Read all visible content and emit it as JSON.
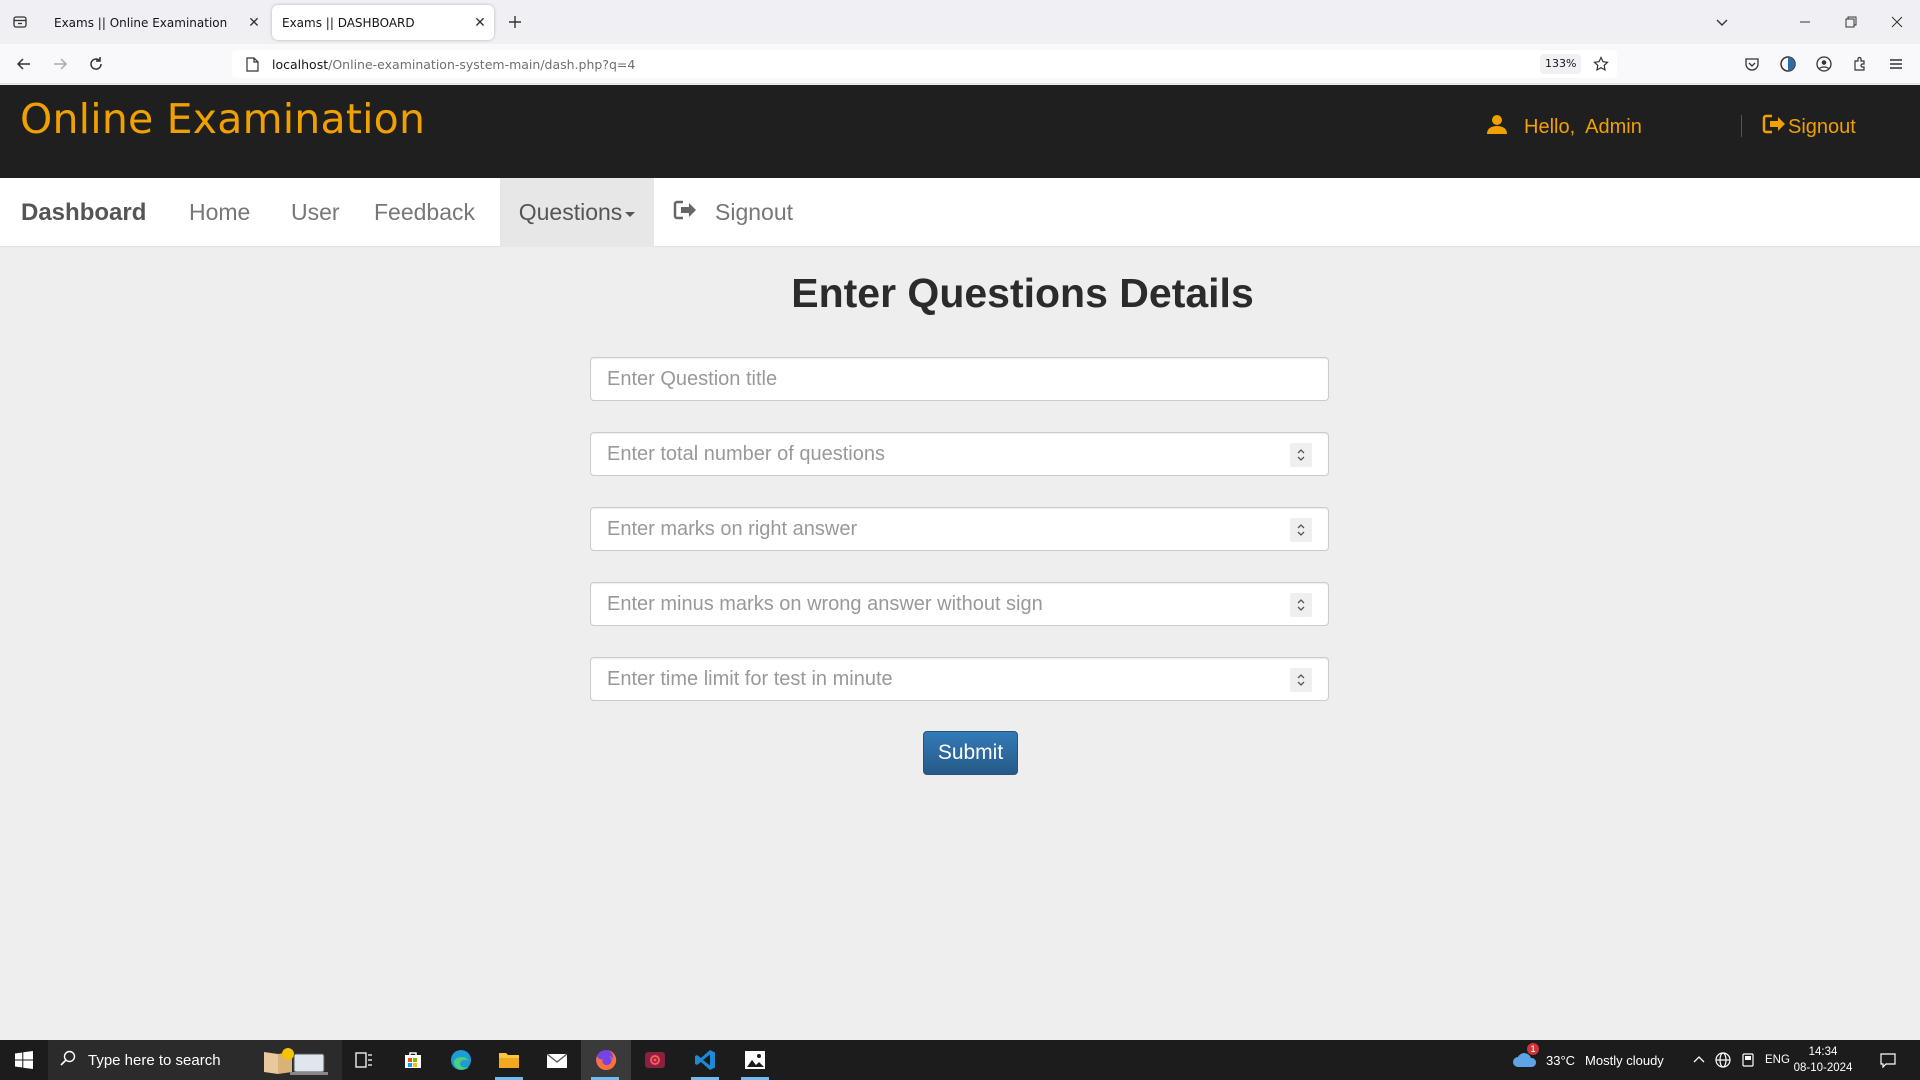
{
  "browser": {
    "tabs": [
      {
        "title": "Exams || Online Examination",
        "active": false
      },
      {
        "title": "Exams || DASHBOARD",
        "active": true
      }
    ],
    "url_host": "localhost",
    "url_path": "/Online-examination-system-main/dash.php?q=4",
    "zoom": "133%"
  },
  "header": {
    "title": "Online Examination",
    "hello": "Hello,",
    "username": "Admin",
    "signout": "Signout"
  },
  "nav": {
    "brand": "Dashboard",
    "items": [
      "Home",
      "User",
      "Feedback",
      "Questions"
    ],
    "signout": "Signout"
  },
  "form": {
    "heading": "Enter Questions Details",
    "fields": [
      {
        "placeholder": "Enter Question title",
        "type": "text"
      },
      {
        "placeholder": "Enter total number of questions",
        "type": "number"
      },
      {
        "placeholder": "Enter marks on right answer",
        "type": "number"
      },
      {
        "placeholder": "Enter minus marks on wrong answer without sign",
        "type": "number"
      },
      {
        "placeholder": "Enter time limit for test in minute",
        "type": "number"
      }
    ],
    "submit": "Submit"
  },
  "taskbar": {
    "search_placeholder": "Type here to search",
    "weather_temp": "33°C",
    "weather_text": "Mostly cloudy",
    "weather_alert": "1",
    "language": "ENG",
    "time": "14:34",
    "date": "08-10-2024"
  },
  "colors": {
    "brand": "#f0a100",
    "header_bg": "#1f1f1f",
    "button": "#2e6da4"
  }
}
